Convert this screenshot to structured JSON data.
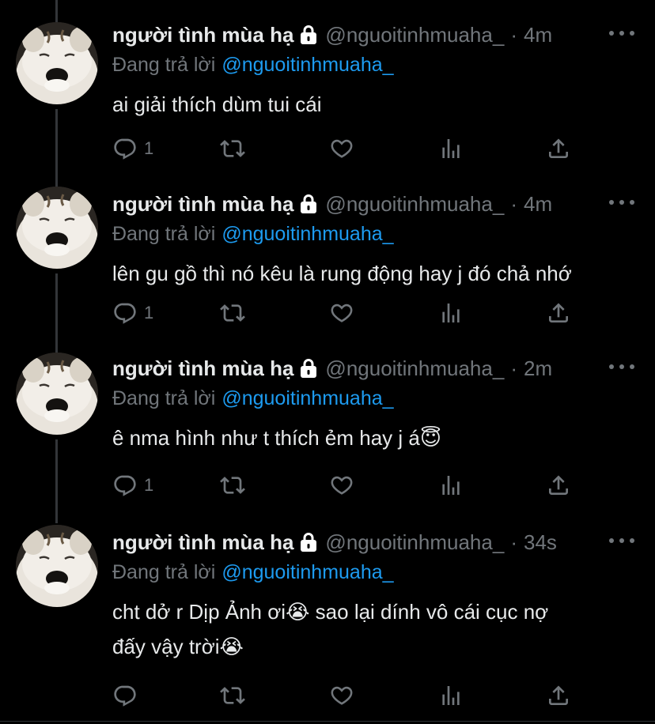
{
  "tweets": [
    {
      "name": "người tình mùa hạ",
      "handle": "@nguoitinhmuaha_",
      "time": "4m",
      "reply_prefix": "Đang trả lời",
      "reply_handle": "@nguoitinhmuaha_",
      "text": "ai giải thích dùm tui cái",
      "reply_count": "1"
    },
    {
      "name": "người tình mùa hạ",
      "handle": "@nguoitinhmuaha_",
      "time": "4m",
      "reply_prefix": "Đang trả lời",
      "reply_handle": "@nguoitinhmuaha_",
      "text": "lên gu gồ thì nó kêu là rung động hay j đó chả nhớ",
      "reply_count": "1"
    },
    {
      "name": "người tình mùa hạ",
      "handle": "@nguoitinhmuaha_",
      "time": "2m",
      "reply_prefix": "Đang trả lời",
      "reply_handle": "@nguoitinhmuaha_",
      "text": "ê nma hình như t thích ẻm hay j á😇",
      "reply_count": "1"
    },
    {
      "name": "người tình mùa hạ",
      "handle": "@nguoitinhmuaha_",
      "time": "34s",
      "reply_prefix": "Đang trả lời",
      "reply_handle": "@nguoitinhmuaha_",
      "text_line1": "cht dở r Dịp Ảnh ơi😭  sao lại dính vô cái cục nợ",
      "text_line2": "đấy vậy trời😭",
      "reply_count": ""
    }
  ],
  "separator": "·",
  "icons": {
    "lock": "lock-icon",
    "more": "more-icon",
    "reply": "reply-icon",
    "retweet": "retweet-icon",
    "like": "heart-icon",
    "analytics": "analytics-icon",
    "share": "share-icon"
  },
  "colors": {
    "background": "#000000",
    "text": "#e7e9ea",
    "muted": "#71767b",
    "link": "#1d9bf0"
  }
}
